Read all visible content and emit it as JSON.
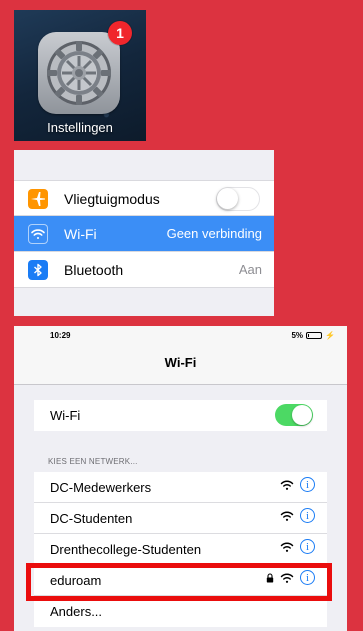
{
  "app_icon": {
    "label": "Instellingen",
    "badge_count": "1",
    "icon": "gear-icon"
  },
  "settings": {
    "rows": [
      {
        "label": "Vliegtuigmodus",
        "icon": "airplane-icon",
        "icon_color": "#ff9500",
        "toggle": "off"
      },
      {
        "label": "Wi-Fi",
        "value": "Geen verbinding",
        "icon": "wifi-icon",
        "icon_color": "#3b8ef6",
        "selected": true
      },
      {
        "label": "Bluetooth",
        "value": "Aan",
        "icon": "bluetooth-icon",
        "icon_color": "#1a7cf5"
      }
    ]
  },
  "wifi_screen": {
    "status_time": "10:29",
    "battery": "5%",
    "title": "Wi-Fi",
    "wifi_toggle_label": "Wi-Fi",
    "wifi_toggle": "on",
    "section_header": "KIES EEN NETWERK...",
    "networks": [
      {
        "name": "DC-Medewerkers",
        "locked": false
      },
      {
        "name": "DC-Studenten",
        "locked": false
      },
      {
        "name": "Drenthecollege-Studenten",
        "locked": false
      },
      {
        "name": "eduroam",
        "locked": true,
        "highlighted": true
      },
      {
        "name": "Anders..."
      }
    ]
  },
  "colors": {
    "background": "#dc3340",
    "highlight": "#ea0d0d",
    "toggle_on": "#4cd964",
    "ios_blue": "#1a7cf5"
  }
}
